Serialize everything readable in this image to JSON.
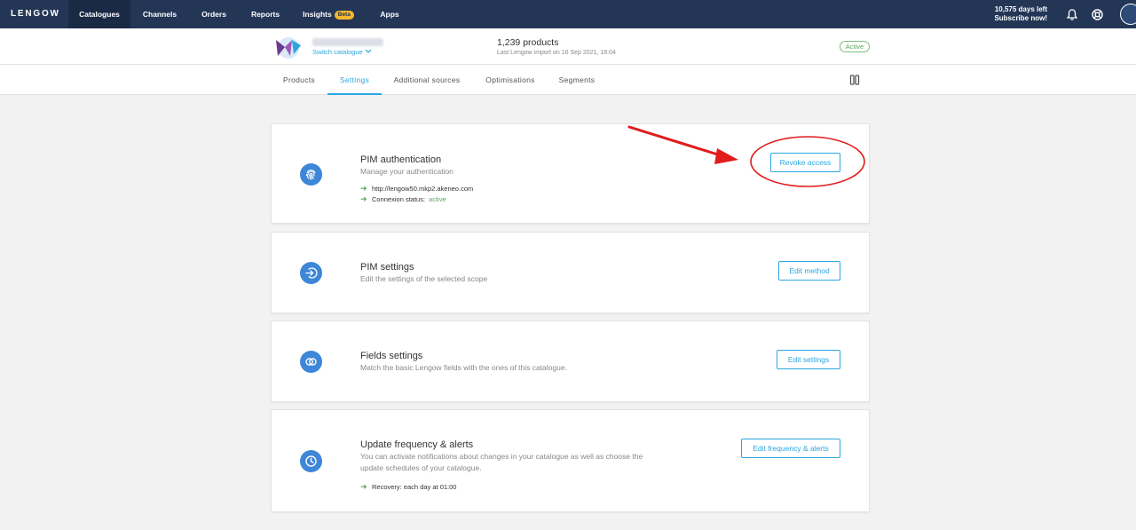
{
  "brand": "LENGOW",
  "nav": {
    "items": [
      {
        "label": "Catalogues"
      },
      {
        "label": "Channels"
      },
      {
        "label": "Orders"
      },
      {
        "label": "Reports"
      },
      {
        "label": "Insights",
        "badge": "Beta"
      },
      {
        "label": "Apps"
      }
    ],
    "days_left": "10,575 days left",
    "subscribe": "Subscribe now!"
  },
  "catalogue": {
    "switch_label": "Switch catalogue",
    "product_count": "1,239 products",
    "last_import": "Last Lengow import on 16 Sep 2021, 18:04",
    "status": "Active"
  },
  "tabs": [
    {
      "label": "Products"
    },
    {
      "label": "Settings",
      "active": true
    },
    {
      "label": "Additional sources"
    },
    {
      "label": "Optimisations"
    },
    {
      "label": "Segments"
    }
  ],
  "cards": {
    "pim_auth": {
      "title": "PIM authentication",
      "desc": "Manage your authentication",
      "url": "http://lengow50.mkp2.akeneo.com",
      "status_label": "Connexion status:",
      "status_value": "active",
      "button": "Revoke access"
    },
    "pim_settings": {
      "title": "PIM settings",
      "desc": "Edit the settings of the selected scope",
      "button": "Edit method"
    },
    "fields": {
      "title": "Fields settings",
      "desc": "Match the basic Lengow fields with the ones of this catalogue.",
      "button": "Edit settings"
    },
    "frequency": {
      "title": "Update frequency & alerts",
      "desc_line1": "You can activate notifications about changes in your catalogue as well as choose the",
      "desc_line2": "update schedules of your catalogue.",
      "recovery": "Recovery: each day at 01:00",
      "button": "Edit frequency & alerts"
    }
  },
  "colors": {
    "nav_bg": "#233656",
    "accent": "#2aa7e0",
    "icon_bg": "#3d86d8",
    "success": "#5aa85a",
    "annotation": "#e11b1b"
  },
  "icons": {
    "bell": "bell-icon",
    "help": "lifebuoy-icon",
    "user": "user-avatar-icon",
    "columns": "columns-icon",
    "fingerprint": "fingerprint-icon",
    "login": "login-arrow-icon",
    "link": "link-rings-icon",
    "clock": "clock-icon"
  }
}
